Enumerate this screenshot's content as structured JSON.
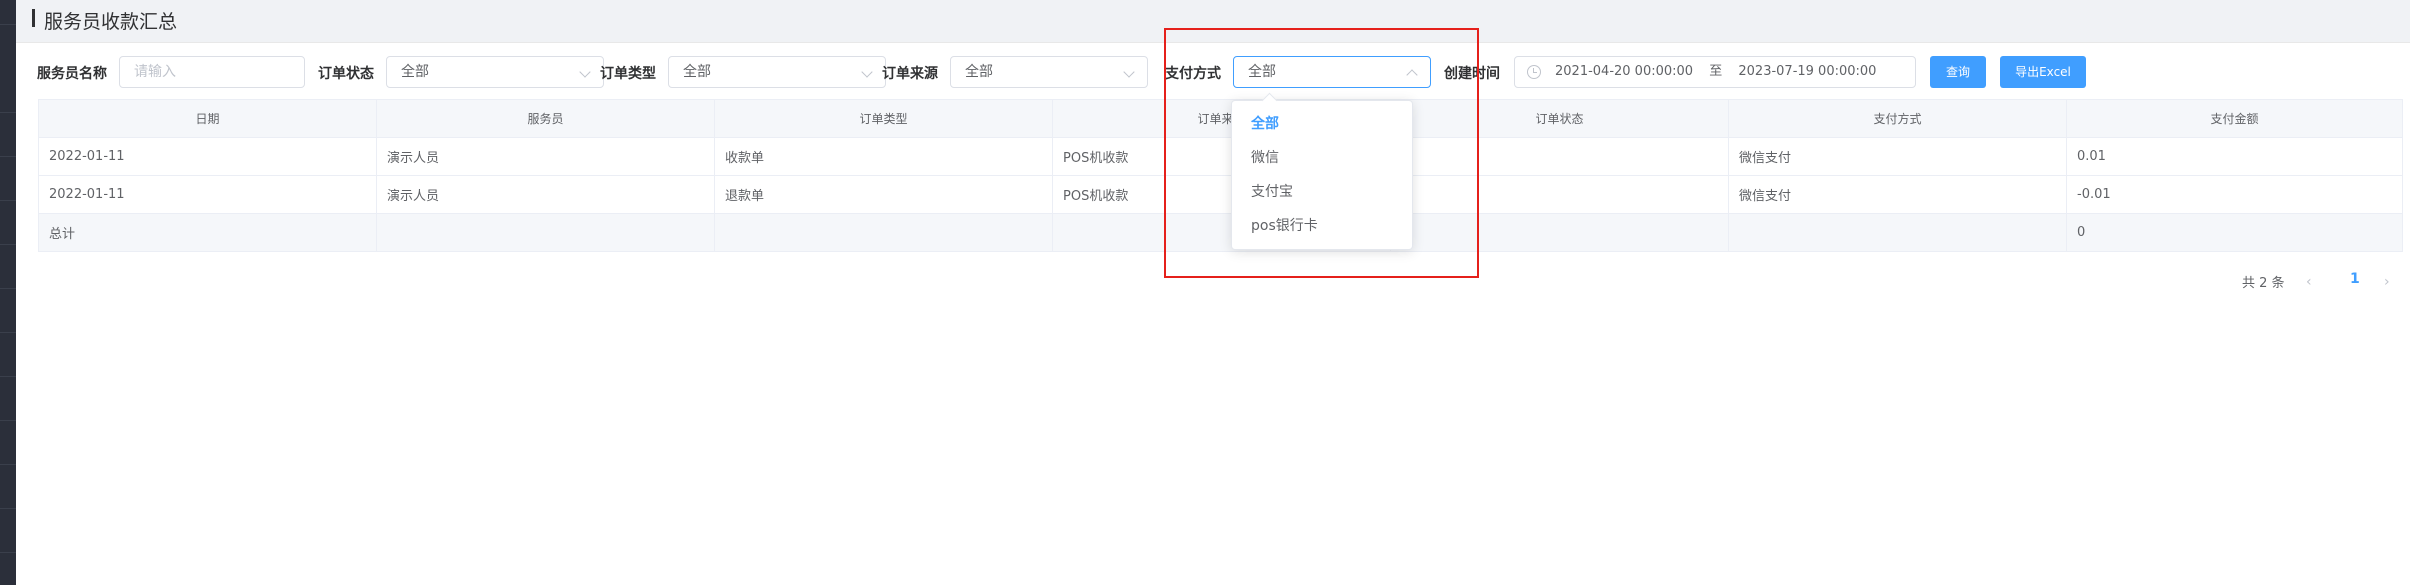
{
  "page_title": "服务员收款汇总",
  "filters": {
    "waiter_name": {
      "label": "服务员名称",
      "placeholder": "请输入"
    },
    "order_status": {
      "label": "订单状态",
      "value": "全部"
    },
    "order_type": {
      "label": "订单类型",
      "value": "全部"
    },
    "order_source": {
      "label": "订单来源",
      "value": "全部"
    },
    "payment_method": {
      "label": "支付方式",
      "value": "全部"
    },
    "created_time": {
      "label": "创建时间",
      "start": "2021-04-20 00:00:00",
      "separator": "至",
      "end": "2023-07-19 00:00:00"
    }
  },
  "buttons": {
    "query": "查询",
    "export": "导出Excel"
  },
  "payment_dropdown": {
    "options": [
      "全部",
      "微信",
      "支付宝",
      "pos银行卡"
    ],
    "selected_index": 0
  },
  "table": {
    "columns": [
      "日期",
      "服务员",
      "订单类型",
      "订单来源",
      "订单状态",
      "支付方式",
      "支付金额"
    ],
    "rows": [
      [
        "2022-01-11",
        "演示人员",
        "收款单",
        "POS机收款",
        "",
        "微信支付",
        "0.01"
      ],
      [
        "2022-01-11",
        "演示人员",
        "退款单",
        "POS机收款",
        "",
        "微信支付",
        "-0.01"
      ]
    ],
    "summary": [
      "总计",
      "",
      "",
      "",
      "",
      "",
      "0"
    ]
  },
  "pagination": {
    "total": "共 2 条",
    "prev": "‹",
    "current": "1",
    "next": "›"
  },
  "colors": {
    "accent": "#409eff",
    "highlight": "#e5201b",
    "header_bg": "#f0f2f5",
    "sidebar": "#2b2f3a"
  }
}
